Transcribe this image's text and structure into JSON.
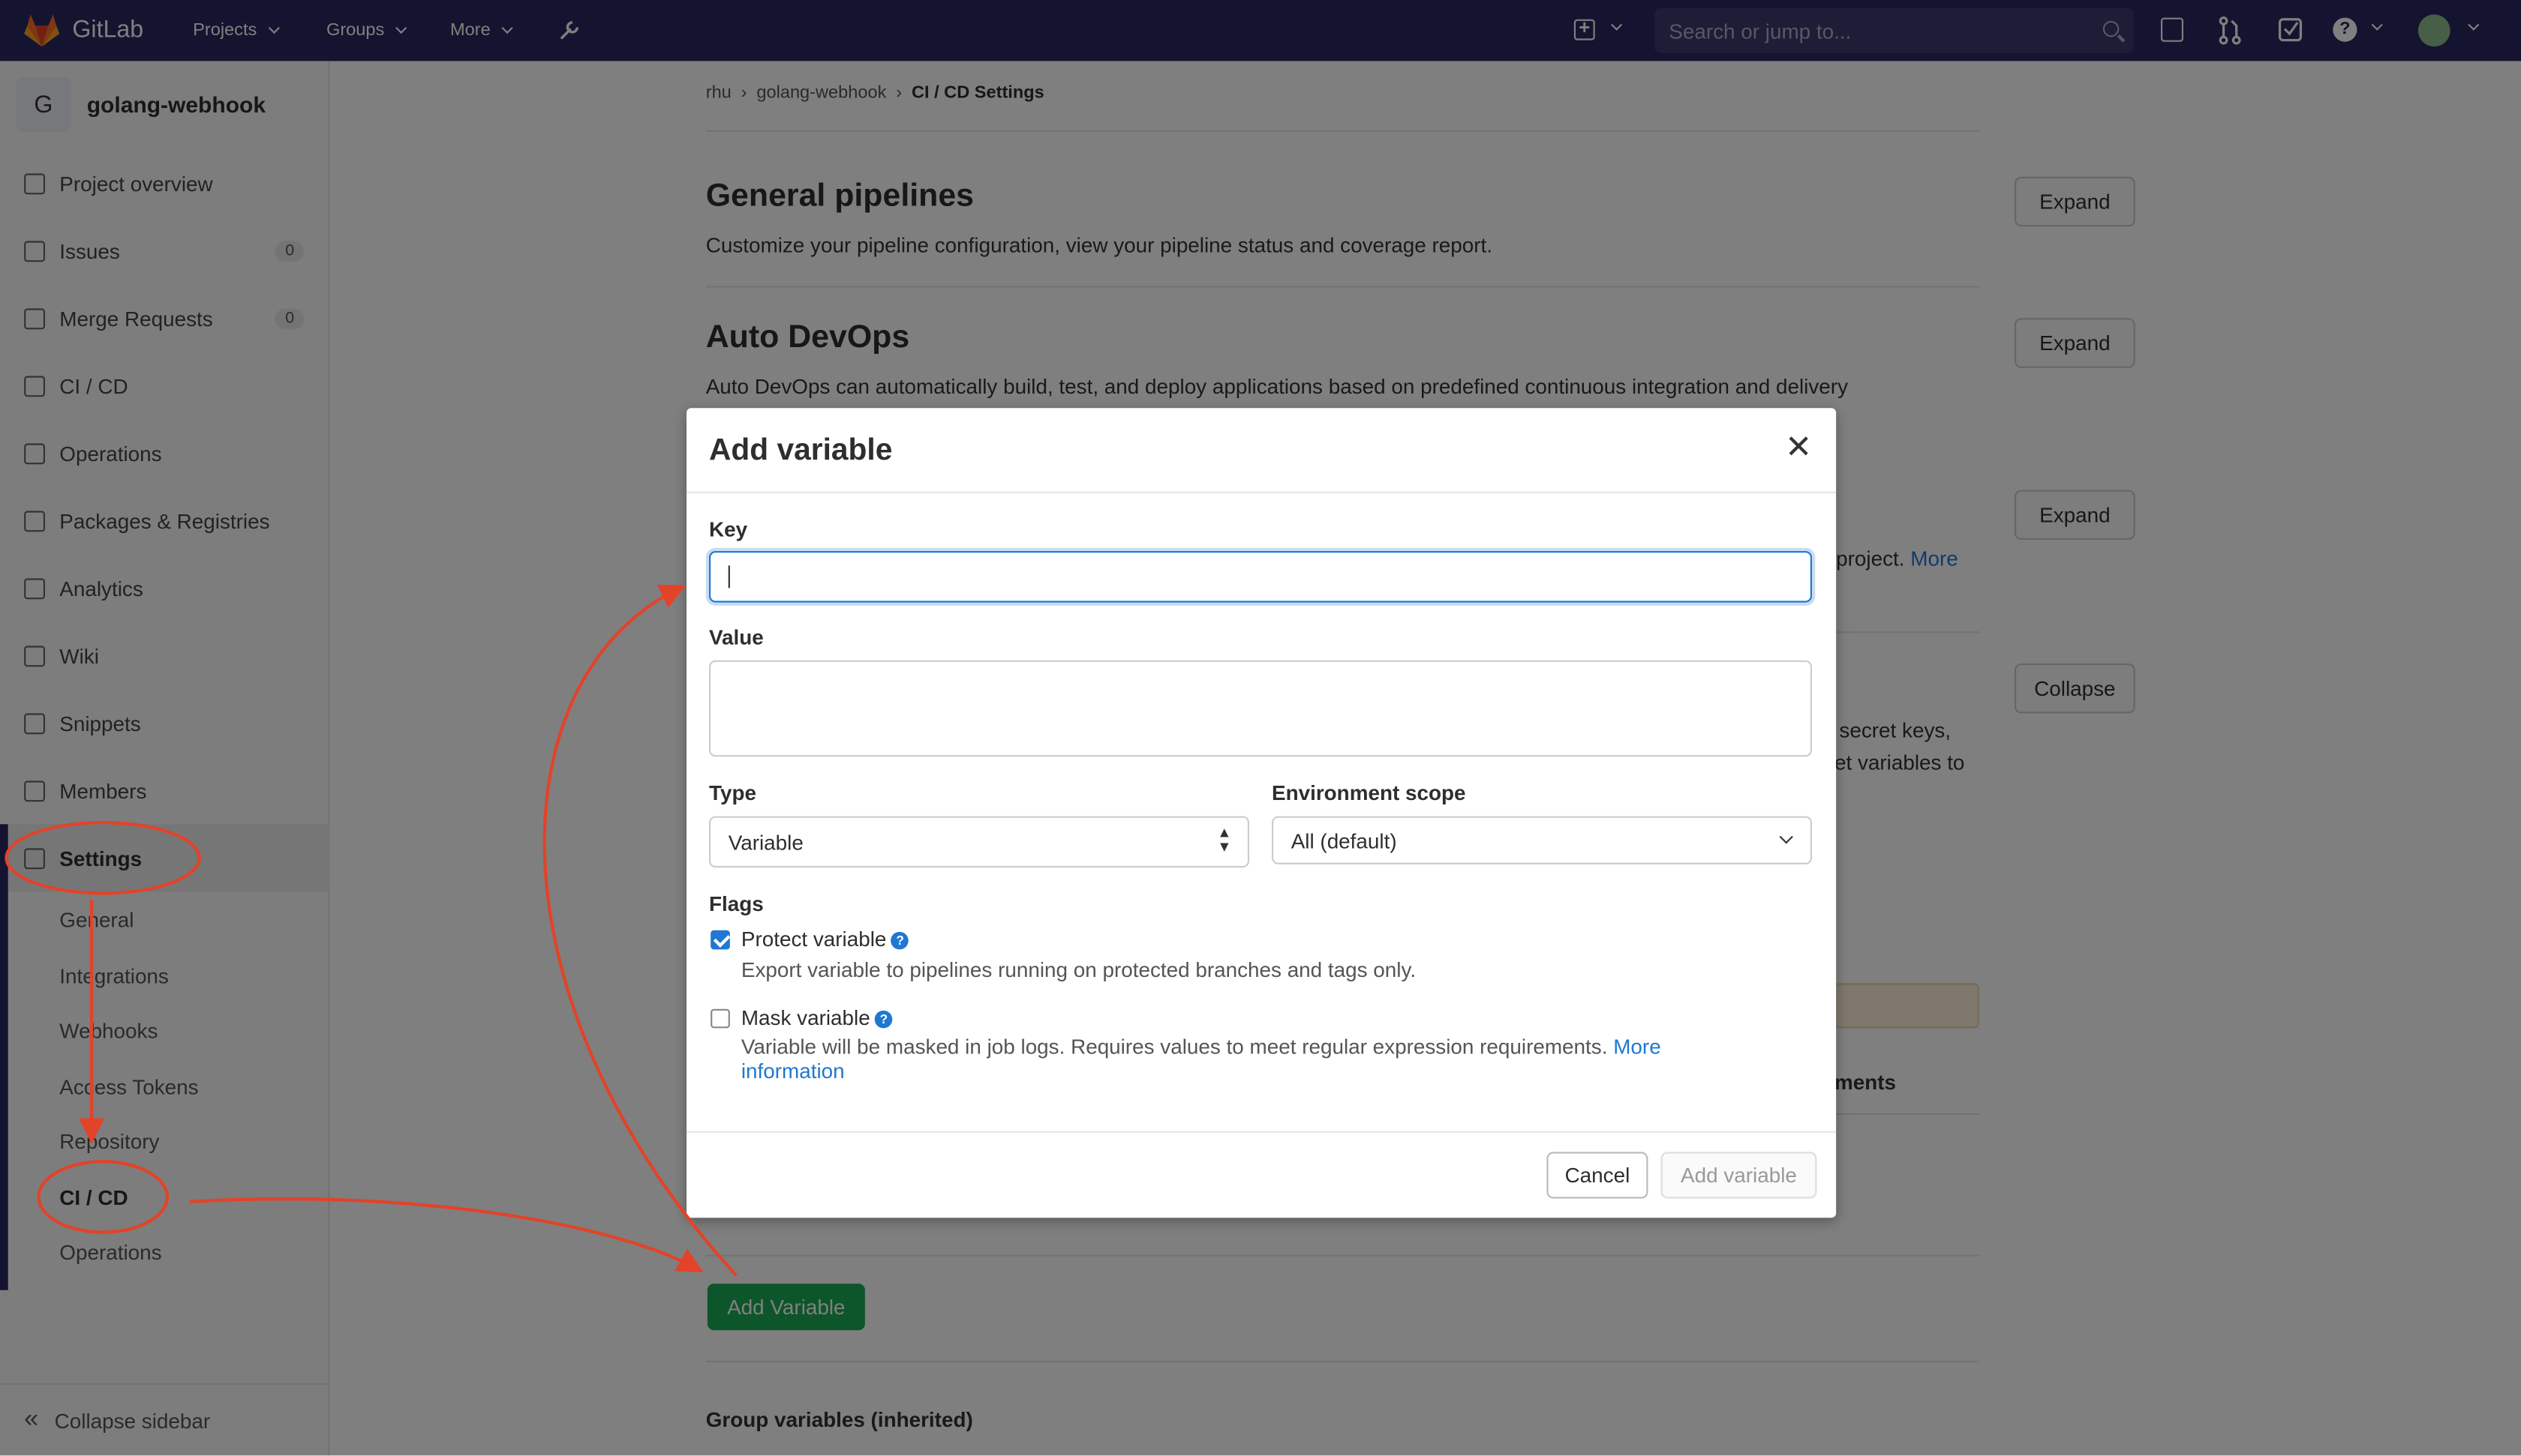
{
  "header": {
    "brand": "GitLab",
    "menus": [
      "Projects",
      "Groups",
      "More"
    ],
    "search_placeholder": "Search or jump to..."
  },
  "sidebar": {
    "avatar_letter": "G",
    "project_name": "golang-webhook",
    "items": [
      {
        "label": "Project overview",
        "icon": "home-icon"
      },
      {
        "label": "Issues",
        "icon": "issues-icon",
        "count": "0"
      },
      {
        "label": "Merge Requests",
        "icon": "merge-request-icon",
        "count": "0"
      },
      {
        "label": "CI / CD",
        "icon": "rocket-icon"
      },
      {
        "label": "Operations",
        "icon": "cloud-gear-icon"
      },
      {
        "label": "Packages & Registries",
        "icon": "package-icon"
      },
      {
        "label": "Analytics",
        "icon": "chart-icon"
      },
      {
        "label": "Wiki",
        "icon": "book-icon"
      },
      {
        "label": "Snippets",
        "icon": "scissors-icon"
      },
      {
        "label": "Members",
        "icon": "users-icon"
      },
      {
        "label": "Settings",
        "icon": "gear-icon"
      }
    ],
    "settings_sub": [
      "General",
      "Integrations",
      "Webhooks",
      "Access Tokens",
      "Repository",
      "CI / CD",
      "Operations"
    ],
    "collapse_label": "Collapse sidebar"
  },
  "breadcrumb": [
    "rhu",
    "golang-webhook",
    "CI / CD Settings"
  ],
  "sections": {
    "general_title": "General pipelines",
    "general_desc": "Customize your pipeline configuration, view your pipeline status and coverage report.",
    "autodevops_title": "Auto DevOps",
    "autodevops_desc": "Auto DevOps can automatically build, test, and deploy applications based on predefined continuous integration and delivery",
    "expand": "Expand",
    "collapse": "Collapse",
    "frag_project": "project.",
    "frag_more": "More",
    "frag_secret": "secret keys,",
    "frag_et": "et variables to",
    "frag_ments": "ments",
    "add_variable_button": "Add Variable",
    "group_vars_title": "Group variables (inherited)"
  },
  "modal": {
    "title": "Add variable",
    "key_label": "Key",
    "key_value": "",
    "value_label": "Value",
    "value_value": "",
    "type_label": "Type",
    "type_selected": "Variable",
    "env_label": "Environment scope",
    "env_selected": "All (default)",
    "flags_label": "Flags",
    "protect_label": "Protect variable",
    "protect_checked": true,
    "protect_hint": "Export variable to pipelines running on protected branches and tags only.",
    "mask_label": "Mask variable",
    "mask_checked": false,
    "mask_hint": "Variable will be masked in job logs. Requires values to meet regular expression requirements.",
    "mask_link_1": "More",
    "mask_link_2": "information",
    "cancel": "Cancel",
    "submit": "Add variable"
  },
  "colors": {
    "header_bg": "#292961",
    "accent": "#1f78d1",
    "annotation": "#e24329",
    "success": "#1aaa55"
  }
}
